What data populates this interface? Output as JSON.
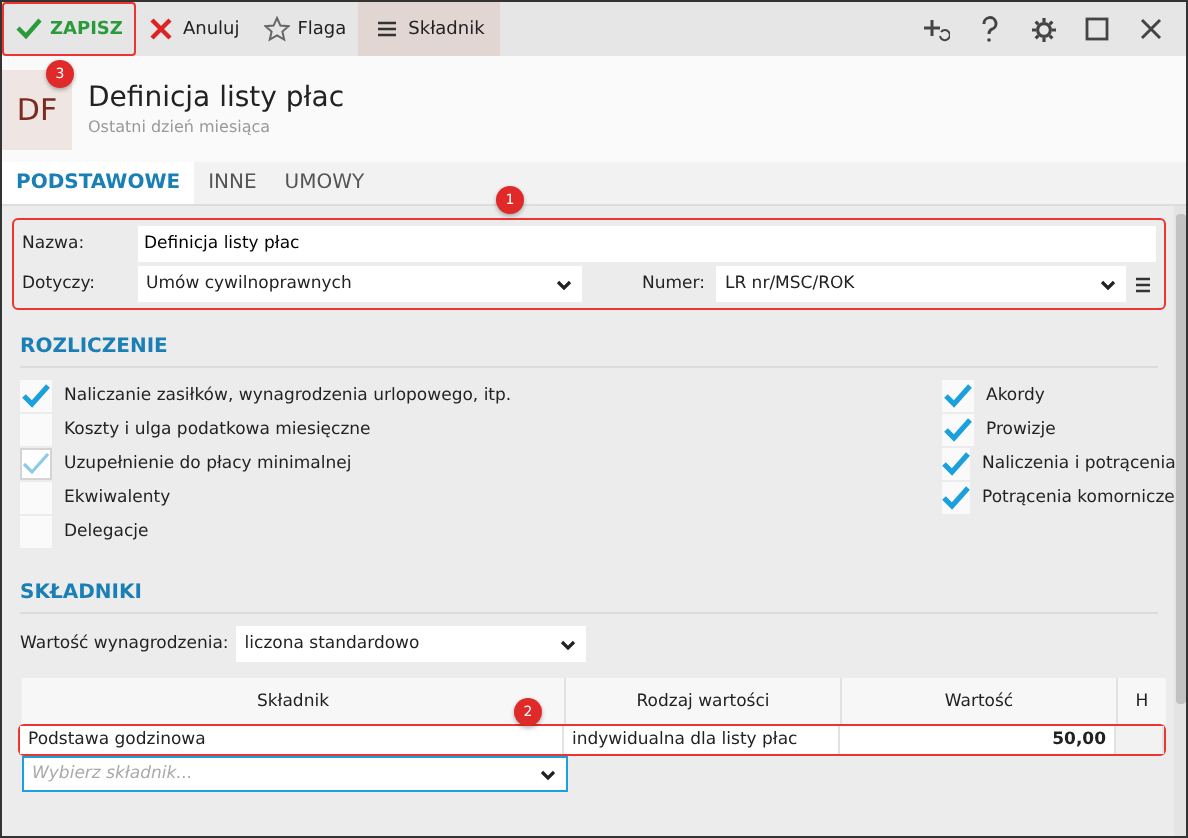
{
  "toolbar": {
    "buttons": [
      {
        "kind": "save",
        "label": "ZAPISZ",
        "highlighted": true,
        "badge": "3"
      },
      {
        "kind": "cancel",
        "label": "Anuluj",
        "highlighted": false
      },
      {
        "kind": "flag",
        "label": "Flaga",
        "highlighted": false
      },
      {
        "kind": "menu",
        "label": "Składnik",
        "highlighted": false
      }
    ]
  },
  "header": {
    "avatar": "DF",
    "title": "Definicja listy płac",
    "subtitle": "Ostatni dzień miesiąca"
  },
  "tabs": [
    {
      "label": "PODSTAWOWE",
      "selected": true
    },
    {
      "label": "INNE",
      "selected": false
    },
    {
      "label": "UMOWY",
      "selected": false
    }
  ],
  "fields": {
    "highlighted": true,
    "badge": "1",
    "name_label": "Nazwa:",
    "name_value": "Definicja listy płac",
    "applies_label": "Dotyczy:",
    "applies_value": "Umów cywilnoprawnych",
    "number_label": "Numer:",
    "number_value": "LR nr/MSC/ROK"
  },
  "settlement": {
    "title": "ROZLICZENIE",
    "left": [
      {
        "label": "Naliczanie zasiłków, wynagrodzenia urlopowego, itp.",
        "checked": true,
        "disabled": false
      },
      {
        "label": "Koszty i ulga podatkowa miesięczne",
        "checked": false,
        "disabled": false
      },
      {
        "label": "Uzupełnienie do płacy minimalnej",
        "checked": true,
        "disabled": true
      },
      {
        "label": "Ekwiwalenty",
        "checked": false,
        "disabled": false
      },
      {
        "label": "Delegacje",
        "checked": false,
        "disabled": false
      }
    ],
    "right": [
      {
        "label": "Akordy",
        "checked": true,
        "disabled": false
      },
      {
        "label": "Prowizje",
        "checked": true,
        "disabled": false
      },
      {
        "label": "Naliczenia i potrącenia",
        "checked": true,
        "disabled": false
      },
      {
        "label": "Potrącenia komornicze",
        "checked": true,
        "disabled": false
      }
    ]
  },
  "components": {
    "title": "SKŁADNIKI",
    "pay_label": "Wartość wynagrodzenia:",
    "pay_value": "liczona standardowo",
    "table": {
      "columns": [
        "Składnik",
        "Rodzaj wartości",
        "Wartość",
        "H"
      ],
      "rows": [
        {
          "cells": [
            "Podstawa godzinowa",
            "indywidualna dla listy płac",
            "50,00"
          ],
          "highlighted": true,
          "badge": "2"
        }
      ]
    },
    "picker_placeholder": "Wybierz składnik..."
  }
}
